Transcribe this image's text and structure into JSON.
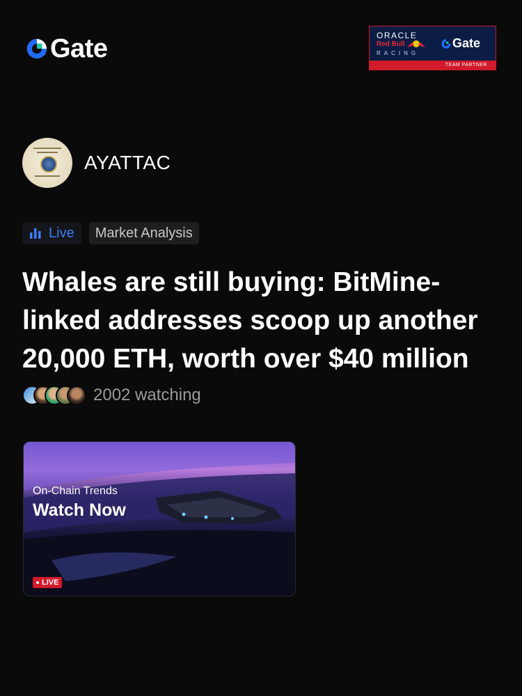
{
  "brand": {
    "name": "Gate",
    "accent": "#1f6bff"
  },
  "partner": {
    "oracle": "ORACLE",
    "redbull": "Red Bull",
    "racing": "RACING",
    "gate": "Gate",
    "tagline": "TEAM PARTNER"
  },
  "author": {
    "name": "AYATTAC",
    "avatar_icon": "certificate-avatar"
  },
  "tags": {
    "live_label": "Live",
    "category_label": "Market Analysis",
    "live_color": "#3d7cf5"
  },
  "article": {
    "title": "Whales are still buying: BitMine-linked addresses scoop up another 20,000 ETH, worth over $40 million"
  },
  "watchers": {
    "count_text": "2002 watching"
  },
  "banner": {
    "kicker": "On-Chain Trends",
    "cta": "Watch Now",
    "live_badge": "LIVE"
  }
}
